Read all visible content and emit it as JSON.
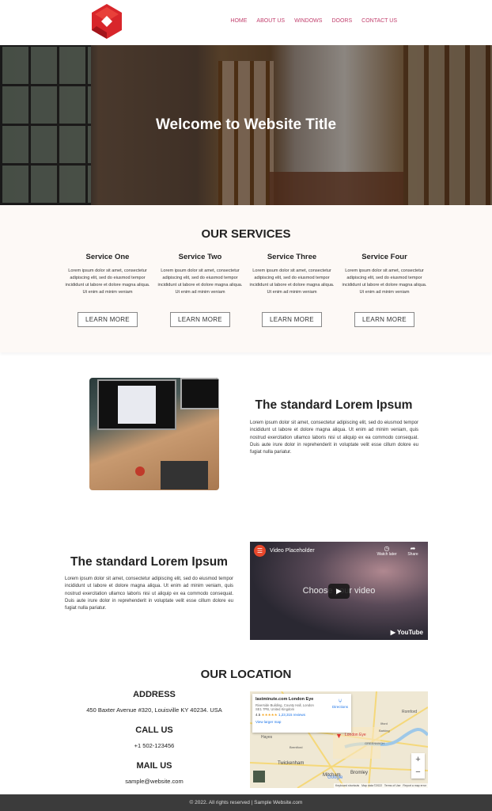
{
  "nav": {
    "items": [
      "HOME",
      "ABOUT US",
      "WINDOWS",
      "DOORS",
      "CONTACT US"
    ]
  },
  "colors": {
    "nav": "#c2416e",
    "logo": "#d8262b",
    "footer": "#3b3b3b",
    "services_bg": "#fdf9f6"
  },
  "hero": {
    "title": "Welcome to Website Title"
  },
  "services": {
    "title": "OUR SERVICES",
    "items": [
      {
        "title": "Service One",
        "text": "Lorem ipsum dolor sit amet, consectetur adipiscing elit, sed do eiusmod tempor incididunt ut labore et dolore magna aliqua. Ut enim ad minim veniam",
        "button": "LEARN MORE"
      },
      {
        "title": "Service Two",
        "text": "Lorem ipsum dolor sit amet, consectetur adipiscing elit, sed do eiusmod tempor incididunt ut labore et dolore magna aliqua. Ut enim ad minim veniam",
        "button": "LEARN MORE"
      },
      {
        "title": "Service Three",
        "text": "Lorem ipsum dolor sit amet, consectetur adipiscing elit, sed do eiusmod tempor incididunt ut labore et dolore magna aliqua. Ut enim ad minim veniam",
        "button": "LEARN MORE"
      },
      {
        "title": "Service Four",
        "text": "Lorem ipsum dolor sit amet, consectetur adipiscing elit, sed do eiusmod tempor incididunt ut labore et dolore magna aliqua. Ut enim ad minim veniam",
        "button": "LEARN MORE"
      }
    ]
  },
  "feature1": {
    "title": "The standard Lorem Ipsum",
    "text": "Lorem ipsum dolor sit amet, consectetur adipiscing elit, sed do eiusmod tempor incididunt ut labore et dolore magna aliqua. Ut enim ad minim veniam, quis nostrud exercitation ullamco laboris nisi ut aliquip ex ea commodo consequat. Duis aute irure dolor in reprehenderit in voluptate velit esse cillum dolore eu fugiat nulla pariatur."
  },
  "feature2": {
    "title": "The standard Lorem Ipsum",
    "text": "Lorem ipsum dolor sit amet, consectetur adipiscing elit, sed do eiusmod tempor incididunt ut labore et dolore magna aliqua. Ut enim ad minim veniam, quis nostrud exercitation ullamco laboris nisi ut aliquip ex ea commodo consequat. Duis aute irure dolor in reprehenderit in voluptate velit esse cillum dolore eu fugiat nulla pariatur."
  },
  "video": {
    "title": "Video Placeholder",
    "center": "Choose your video",
    "watch_later": "Watch later",
    "share": "Share",
    "brand": "YouTube"
  },
  "location": {
    "title": "OUR LOCATION",
    "address_label": "ADDRESS",
    "address": "450 Baxter Avenue #320, Louisville KY 40234. USA",
    "call_label": "CALL US",
    "phone": "+1 502-123456",
    "mail_label": "MAIL US",
    "email": "sample@website.com"
  },
  "map": {
    "place": "lastminute.com London Eye",
    "addr": "Riverside Building, County Hall, London SE1 7PB, United Kingdom",
    "rating": "4.5",
    "stars": "★★★★★",
    "reviews": "1,23,315 reviews",
    "larger": "View larger map",
    "directions": "Directions",
    "pin_label": "London Eye",
    "labels": [
      "Hayes",
      "Romford",
      "Twickenham",
      "Bromley",
      "Mitcham",
      "Brentford",
      "Ilford",
      "Barking",
      "GREENWICH"
    ],
    "attribution": "Keyboard shortcuts   Map data ©2022   Terms of Use   Report a map error",
    "google": "Google"
  },
  "footer": {
    "text": "© 2022. All rights reserved | Sample Website.com"
  }
}
